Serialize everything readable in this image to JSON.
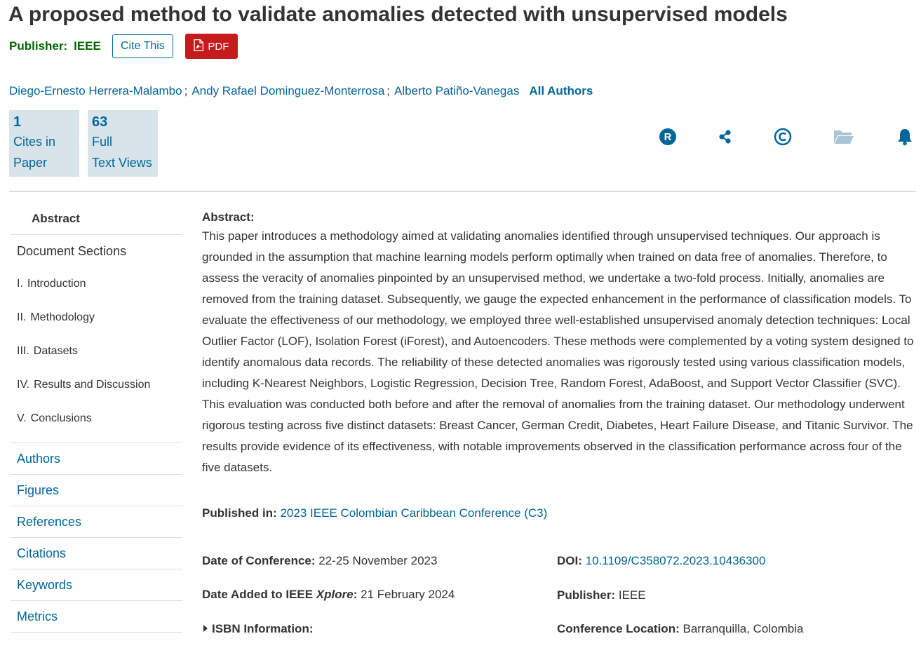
{
  "paper": {
    "title": "A proposed method to validate anomalies detected with unsupervised models",
    "publisher_label": "Publisher:",
    "publisher_name": "IEEE"
  },
  "actions": {
    "cite_label": "Cite This",
    "pdf_label": "PDF"
  },
  "authors": {
    "list": [
      "Diego-Ernesto Herrera-Malambo",
      "Andy Rafael Dominguez-Monterrosa",
      "Alberto Patiño-Vanegas"
    ],
    "separator": ";",
    "all_label": "All Authors"
  },
  "metrics": {
    "cites": {
      "value": "1",
      "line1": "Cites in",
      "line2": "Paper"
    },
    "views": {
      "value": "63",
      "line1": "Full",
      "line2": "Text Views"
    }
  },
  "toolbar_icons": [
    "rights-icon",
    "share-icon",
    "copyright-icon",
    "folder-icon",
    "bell-icon"
  ],
  "colors": {
    "link": "#006699",
    "publisher": "#006600",
    "pdf": "#c61b1b",
    "metric_bg": "#d9e4ea"
  },
  "sidebar": {
    "abstract_label": "Abstract",
    "doc_sections_label": "Document Sections",
    "sections": [
      {
        "num": "I.",
        "label": "Introduction"
      },
      {
        "num": "II.",
        "label": "Methodology"
      },
      {
        "num": "III.",
        "label": "Datasets"
      },
      {
        "num": "IV.",
        "label": "Results and Discussion"
      },
      {
        "num": "V.",
        "label": "Conclusions"
      }
    ],
    "links": [
      "Authors",
      "Figures",
      "References",
      "Citations",
      "Keywords",
      "Metrics"
    ]
  },
  "abstract": {
    "heading": "Abstract:",
    "text": "This paper introduces a methodology aimed at validating anomalies identified through unsupervised techniques. Our approach is grounded in the assumption that machine learning models perform optimally when trained on data free of anomalies. Therefore, to assess the veracity of anomalies pinpointed by an unsupervised method, we undertake a two-fold process. Initially, anomalies are removed from the training dataset. Subsequently, we gauge the expected enhancement in the performance of classification models. To evaluate the effectiveness of our methodology, we employed three well-established unsupervised anomaly detection techniques: Local Outlier Factor (LOF), Isolation Forest (iForest), and Autoencoders. These methods were complemented by a voting system designed to identify anomalous data records. The reliability of these detected anomalies was rigorously tested using various classification models, including K-Nearest Neighbors, Logistic Regression, Decision Tree, Random Forest, AdaBoost, and Support Vector Classifier (SVC). This evaluation was conducted both before and after the removal of anomalies from the training dataset. Our methodology underwent rigorous testing across five distinct datasets: Breast Cancer, German Credit, Diabetes, Heart Failure Disease, and Titanic Survivor. The results provide evidence of its effectiveness, with notable improvements observed in the classification performance across four of the five datasets."
  },
  "details": {
    "published_in_label": "Published in:",
    "published_in_value": "2023 IEEE Colombian Caribbean Conference (C3)",
    "date_conf_label": "Date of Conference:",
    "date_conf_value": "22-25 November 2023",
    "date_added_label": "Date Added to IEEE",
    "date_added_italic": "Xplore",
    "date_added_value": "21 February 2024",
    "isbn_label": "ISBN Information:",
    "doi_label": "DOI:",
    "doi_value": "10.1109/C358072.2023.10436300",
    "publisher_label": "Publisher:",
    "publisher_value": "IEEE",
    "location_label": "Conference Location:",
    "location_value": "Barranquilla, Colombia"
  }
}
